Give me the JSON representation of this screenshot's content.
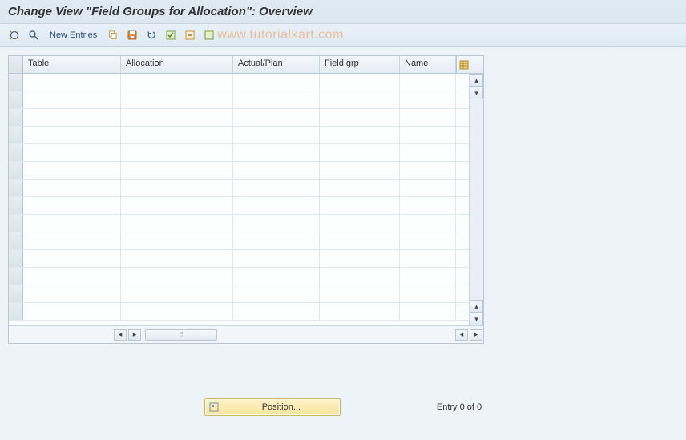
{
  "header": {
    "title": "Change View \"Field Groups for Allocation\": Overview"
  },
  "toolbar": {
    "new_entries_label": "New Entries"
  },
  "watermark": "www.tutorialkart.com",
  "table": {
    "columns": {
      "table": "Table",
      "allocation": "Allocation",
      "actual_plan": "Actual/Plan",
      "field_grp": "Field grp",
      "name": "Name"
    },
    "rows": []
  },
  "footer": {
    "position_label": "Position...",
    "entry_text": "Entry 0 of 0"
  }
}
